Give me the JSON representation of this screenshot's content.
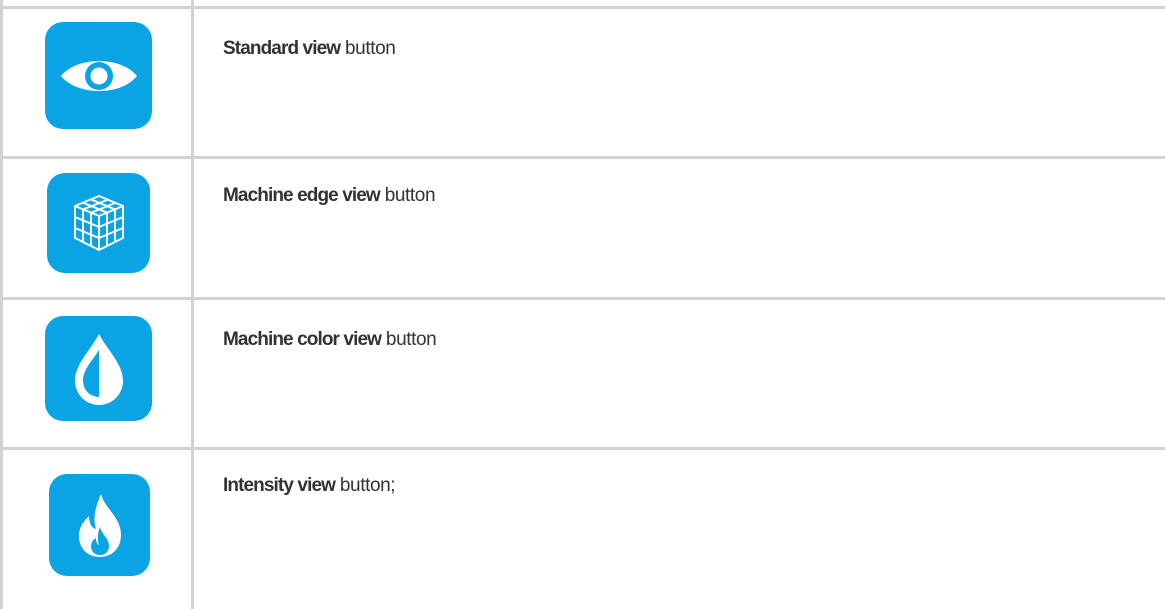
{
  "rows": [
    {
      "icon": "eye-icon",
      "name_bold": "Standard view",
      "suffix": " button"
    },
    {
      "icon": "cube-wireframe-icon",
      "name_bold": "Machine edge view",
      "suffix": " button"
    },
    {
      "icon": "half-drop-icon",
      "name_bold": "Machine color view",
      "suffix": " button"
    },
    {
      "icon": "flame-icon",
      "name_bold": "Intensity view",
      "suffix": " button;"
    }
  ],
  "colors": {
    "icon_background": "#0aa3e3",
    "grid_line": "#d2d2d2",
    "text": "#333333"
  }
}
